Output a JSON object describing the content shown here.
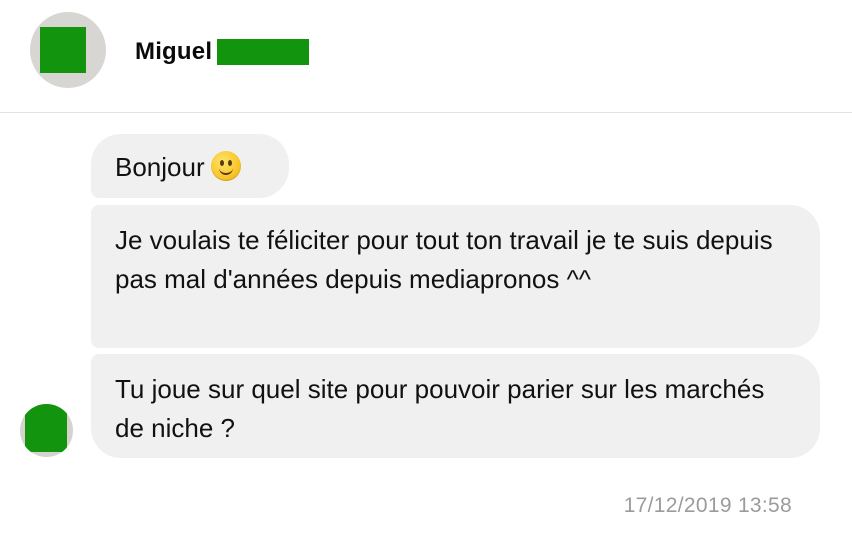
{
  "contact": {
    "name": "Miguel"
  },
  "messages": [
    {
      "text": "Bonjour",
      "emoji": "slightly-smiling-face"
    },
    {
      "text": "Je voulais te féliciter pour tout ton travail je te suis depuis pas mal d'années depuis mediapronos ^^"
    },
    {
      "text": "Tu joue sur quel site pour pouvoir parier sur les marchés de niche ?"
    }
  ],
  "timestamp": "17/12/2019 13:58",
  "colors": {
    "bubble": "#f0f0f0",
    "censor": "#12940f",
    "timestamp": "#9b9b9b"
  }
}
